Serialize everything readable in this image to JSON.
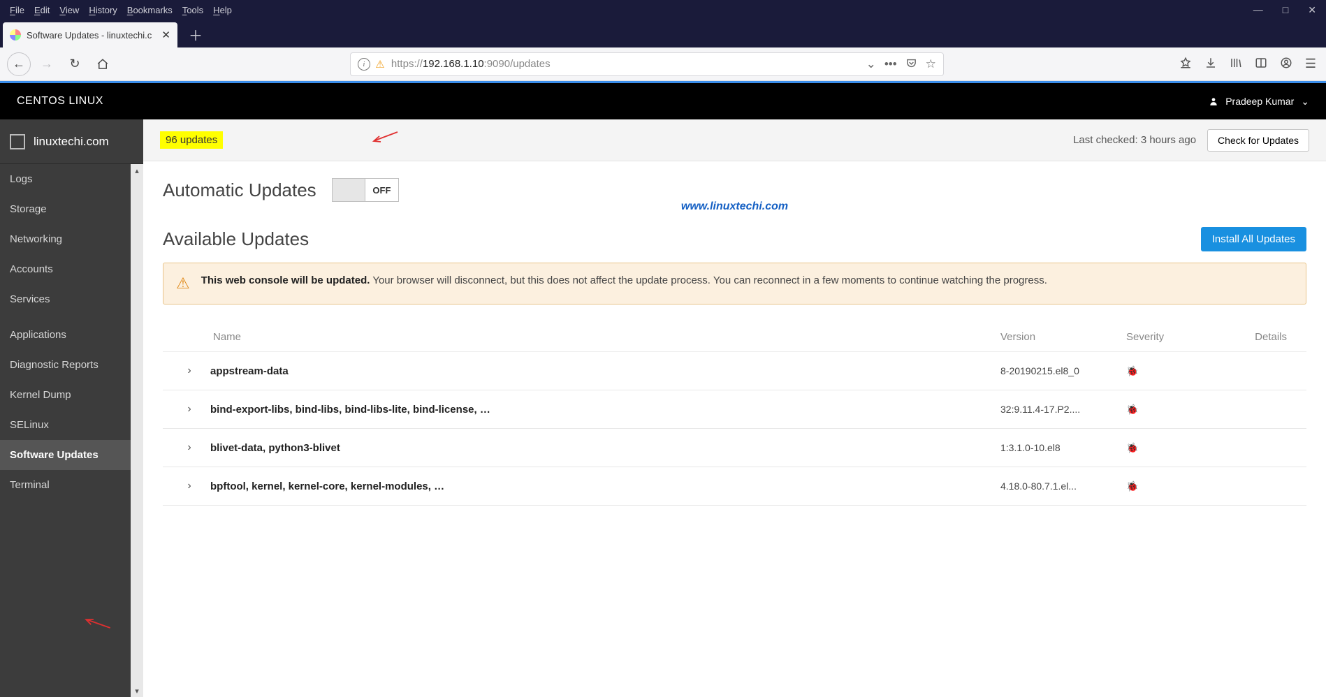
{
  "window": {
    "menu": [
      "File",
      "Edit",
      "View",
      "History",
      "Bookmarks",
      "Tools",
      "Help"
    ]
  },
  "tab": {
    "title": "Software Updates - linuxtechi.c"
  },
  "url": {
    "scheme": "https://",
    "host": "192.168.1.10",
    "rest": ":9090/updates"
  },
  "cockpit": {
    "brand": "CENTOS LINUX",
    "user": "Pradeep Kumar"
  },
  "host": {
    "name": "linuxtechi.com"
  },
  "sidebar": {
    "items": [
      {
        "label": "Logs"
      },
      {
        "label": "Storage"
      },
      {
        "label": "Networking"
      },
      {
        "label": "Accounts"
      },
      {
        "label": "Services"
      },
      {
        "label": "Applications",
        "spacer": true
      },
      {
        "label": "Diagnostic Reports"
      },
      {
        "label": "Kernel Dump"
      },
      {
        "label": "SELinux"
      },
      {
        "label": "Software Updates",
        "active": true
      },
      {
        "label": "Terminal"
      }
    ]
  },
  "status": {
    "badge": "96 updates",
    "last_checked": "Last checked: 3 hours ago",
    "check_btn": "Check for Updates"
  },
  "auto_updates": {
    "title": "Automatic Updates",
    "state": "OFF"
  },
  "watermark": "www.linuxtechi.com",
  "available": {
    "title": "Available Updates",
    "install_btn": "Install All Updates"
  },
  "alert": {
    "strong": "This web console will be updated.",
    "rest": " Your browser will disconnect, but this does not affect the update process. You can reconnect in a few moments to continue watching the progress."
  },
  "table": {
    "headers": {
      "name": "Name",
      "version": "Version",
      "severity": "Severity",
      "details": "Details"
    },
    "rows": [
      {
        "name": "appstream-data",
        "version": "8-20190215.el8_0"
      },
      {
        "name": "bind-export-libs, bind-libs, bind-libs-lite, bind-license, …",
        "version": "32:9.11.4-17.P2...."
      },
      {
        "name": "blivet-data, python3-blivet",
        "version": "1:3.1.0-10.el8"
      },
      {
        "name": "bpftool, kernel, kernel-core, kernel-modules, …",
        "version": "4.18.0-80.7.1.el..."
      }
    ]
  }
}
